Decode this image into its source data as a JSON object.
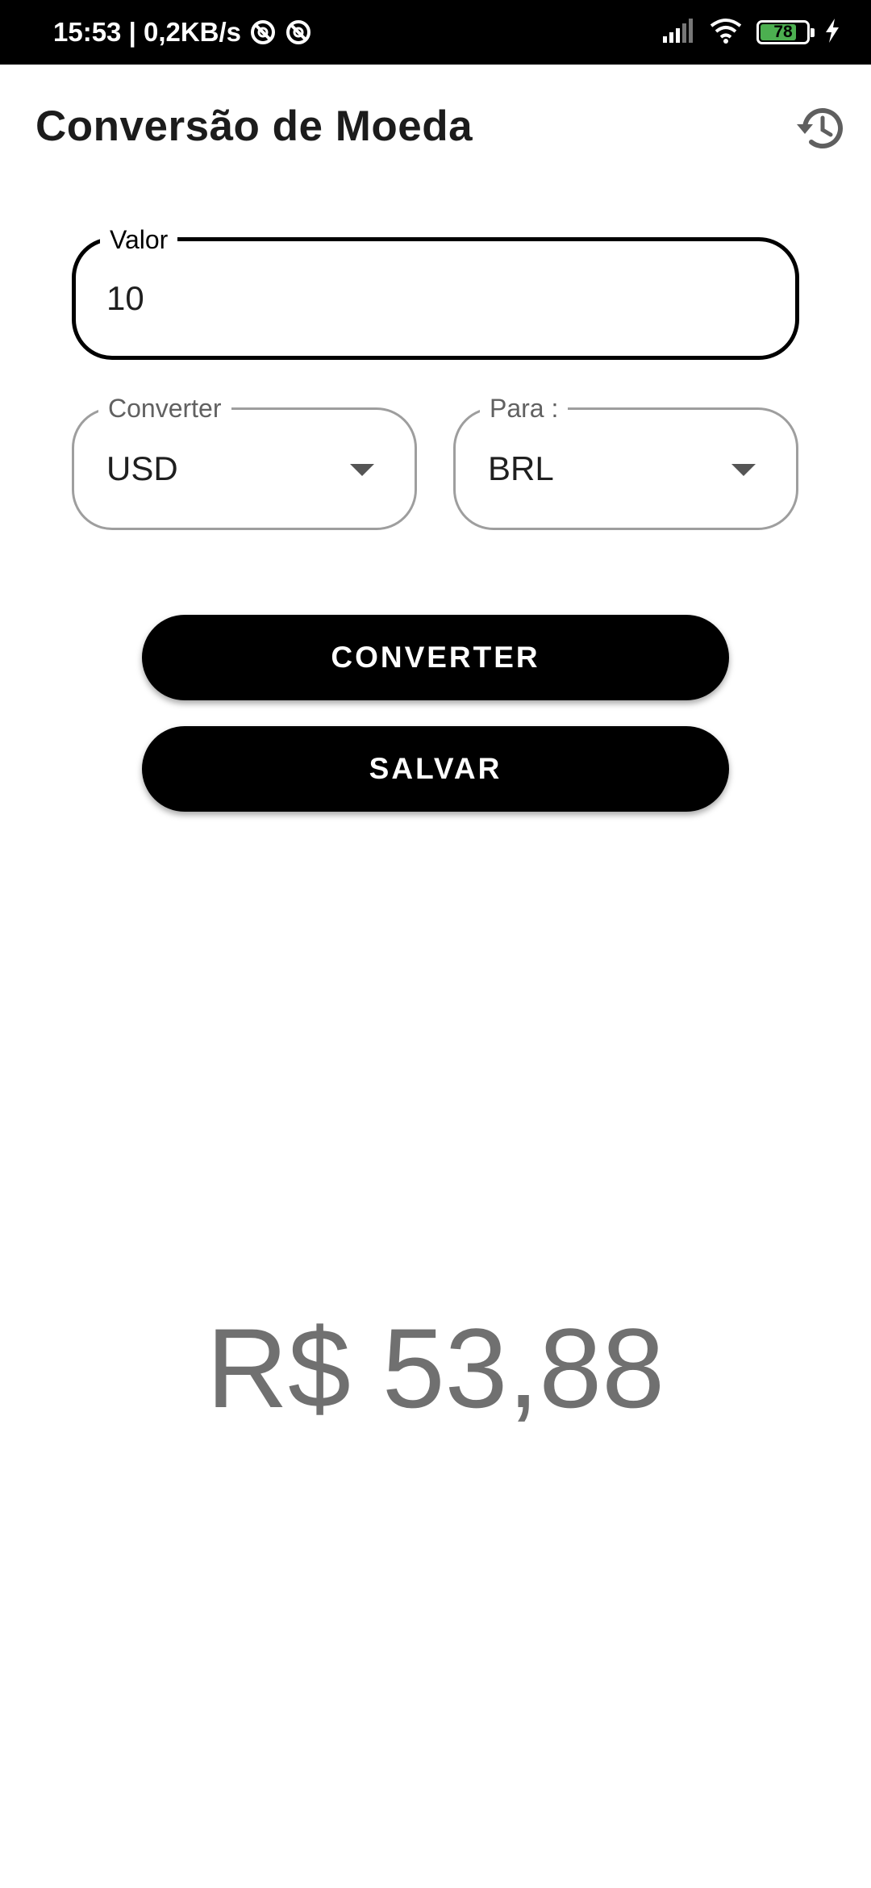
{
  "status_bar": {
    "time_speed": "15:53 | 0,2KB/s",
    "battery": "78",
    "battery_level": 0.78,
    "icons": [
      "dnd-icon",
      "dnd-icon",
      "signal-icon",
      "wifi-icon",
      "battery-icon",
      "charging-icon"
    ]
  },
  "app_bar": {
    "title": "Conversão de Moeda",
    "history_icon": "history-icon"
  },
  "form": {
    "amount": {
      "label": "Valor",
      "value": "10"
    },
    "from": {
      "label": "Converter",
      "value": "USD"
    },
    "to": {
      "label": "Para :",
      "value": "BRL"
    }
  },
  "buttons": {
    "convert": "CONVERTER",
    "save": "SALVAR"
  },
  "result": "R$ 53,88",
  "colors": {
    "accent": "#000000",
    "result_text": "#707070",
    "battery_fill": "#4caf50"
  }
}
